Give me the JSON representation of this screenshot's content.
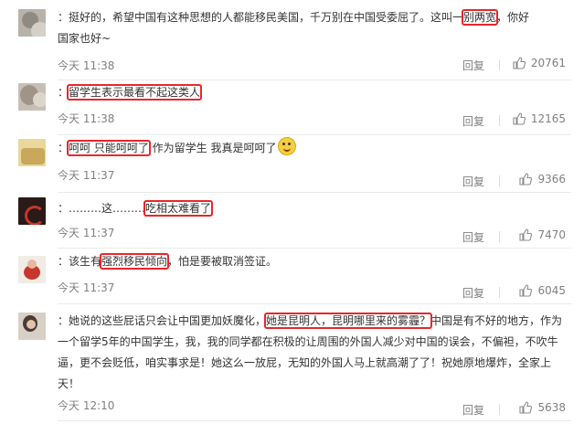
{
  "comments": [
    {
      "segments": [
        {
          "text": "：挺好的，希望中国有这种思想的人都能移民美国，千万别在中国受委屈了。这叫一",
          "hl": false
        },
        {
          "text": "别两宽",
          "hl": true
        },
        {
          "text": "，你好",
          "hl": false
        }
      ],
      "line2": "国家也好~",
      "time": "今天 11:38",
      "reply": "回复",
      "likes": "20761"
    },
    {
      "segments": [
        {
          "text": "：",
          "hl": false
        },
        {
          "text": "留学生表示最看不起这类人",
          "hl": true
        }
      ],
      "time": "今天 11:38",
      "reply": "回复",
      "likes": "12165"
    },
    {
      "segments": [
        {
          "text": "：",
          "hl": false
        },
        {
          "text": "呵呵 只能呵呵了",
          "hl": true
        },
        {
          "text": " 作为留学生 我真是呵呵了",
          "hl": false
        }
      ],
      "time": "今天 11:37",
      "reply": "回复",
      "likes": "9366"
    },
    {
      "segments": [
        {
          "text": "：………这………",
          "hl": false
        },
        {
          "text": "吃相太难看了",
          "hl": true
        }
      ],
      "time": "今天 11:37",
      "reply": "回复",
      "likes": "7470"
    },
    {
      "segments": [
        {
          "text": "：该生有",
          "hl": false
        },
        {
          "text": "强烈移民倾向",
          "hl": true
        },
        {
          "text": "，怕是要被取消签证。",
          "hl": false
        }
      ],
      "time": "今天 11:37",
      "reply": "回复",
      "likes": "6045"
    },
    {
      "segments": [
        {
          "text": "：她说的这些屁话只会让中国更加妖魔化，",
          "hl": false
        },
        {
          "text": "她是昆明人，昆明哪里来的雾霾？",
          "hl": true
        },
        {
          "text": "中国是有不好的地方，作为一个留学5年的中国学生，我，我的同学都在积极的让周围的外国人减少对中国的误会，不偏袒，不吹牛逼，更不会贬低，咱实事求是！她这么一放屁，无知的外国人马上就高潮了了！祝她原地爆炸，全家上天！",
          "hl": false
        }
      ],
      "time": "今天 12:10",
      "reply": "回复",
      "likes": "5638"
    }
  ],
  "colors": {
    "highlight": "#e8272c",
    "meta": "#808080",
    "text": "#333333"
  },
  "icons": {
    "like": "thumbs-up-icon",
    "emoji": "laughing-emoji-icon"
  }
}
